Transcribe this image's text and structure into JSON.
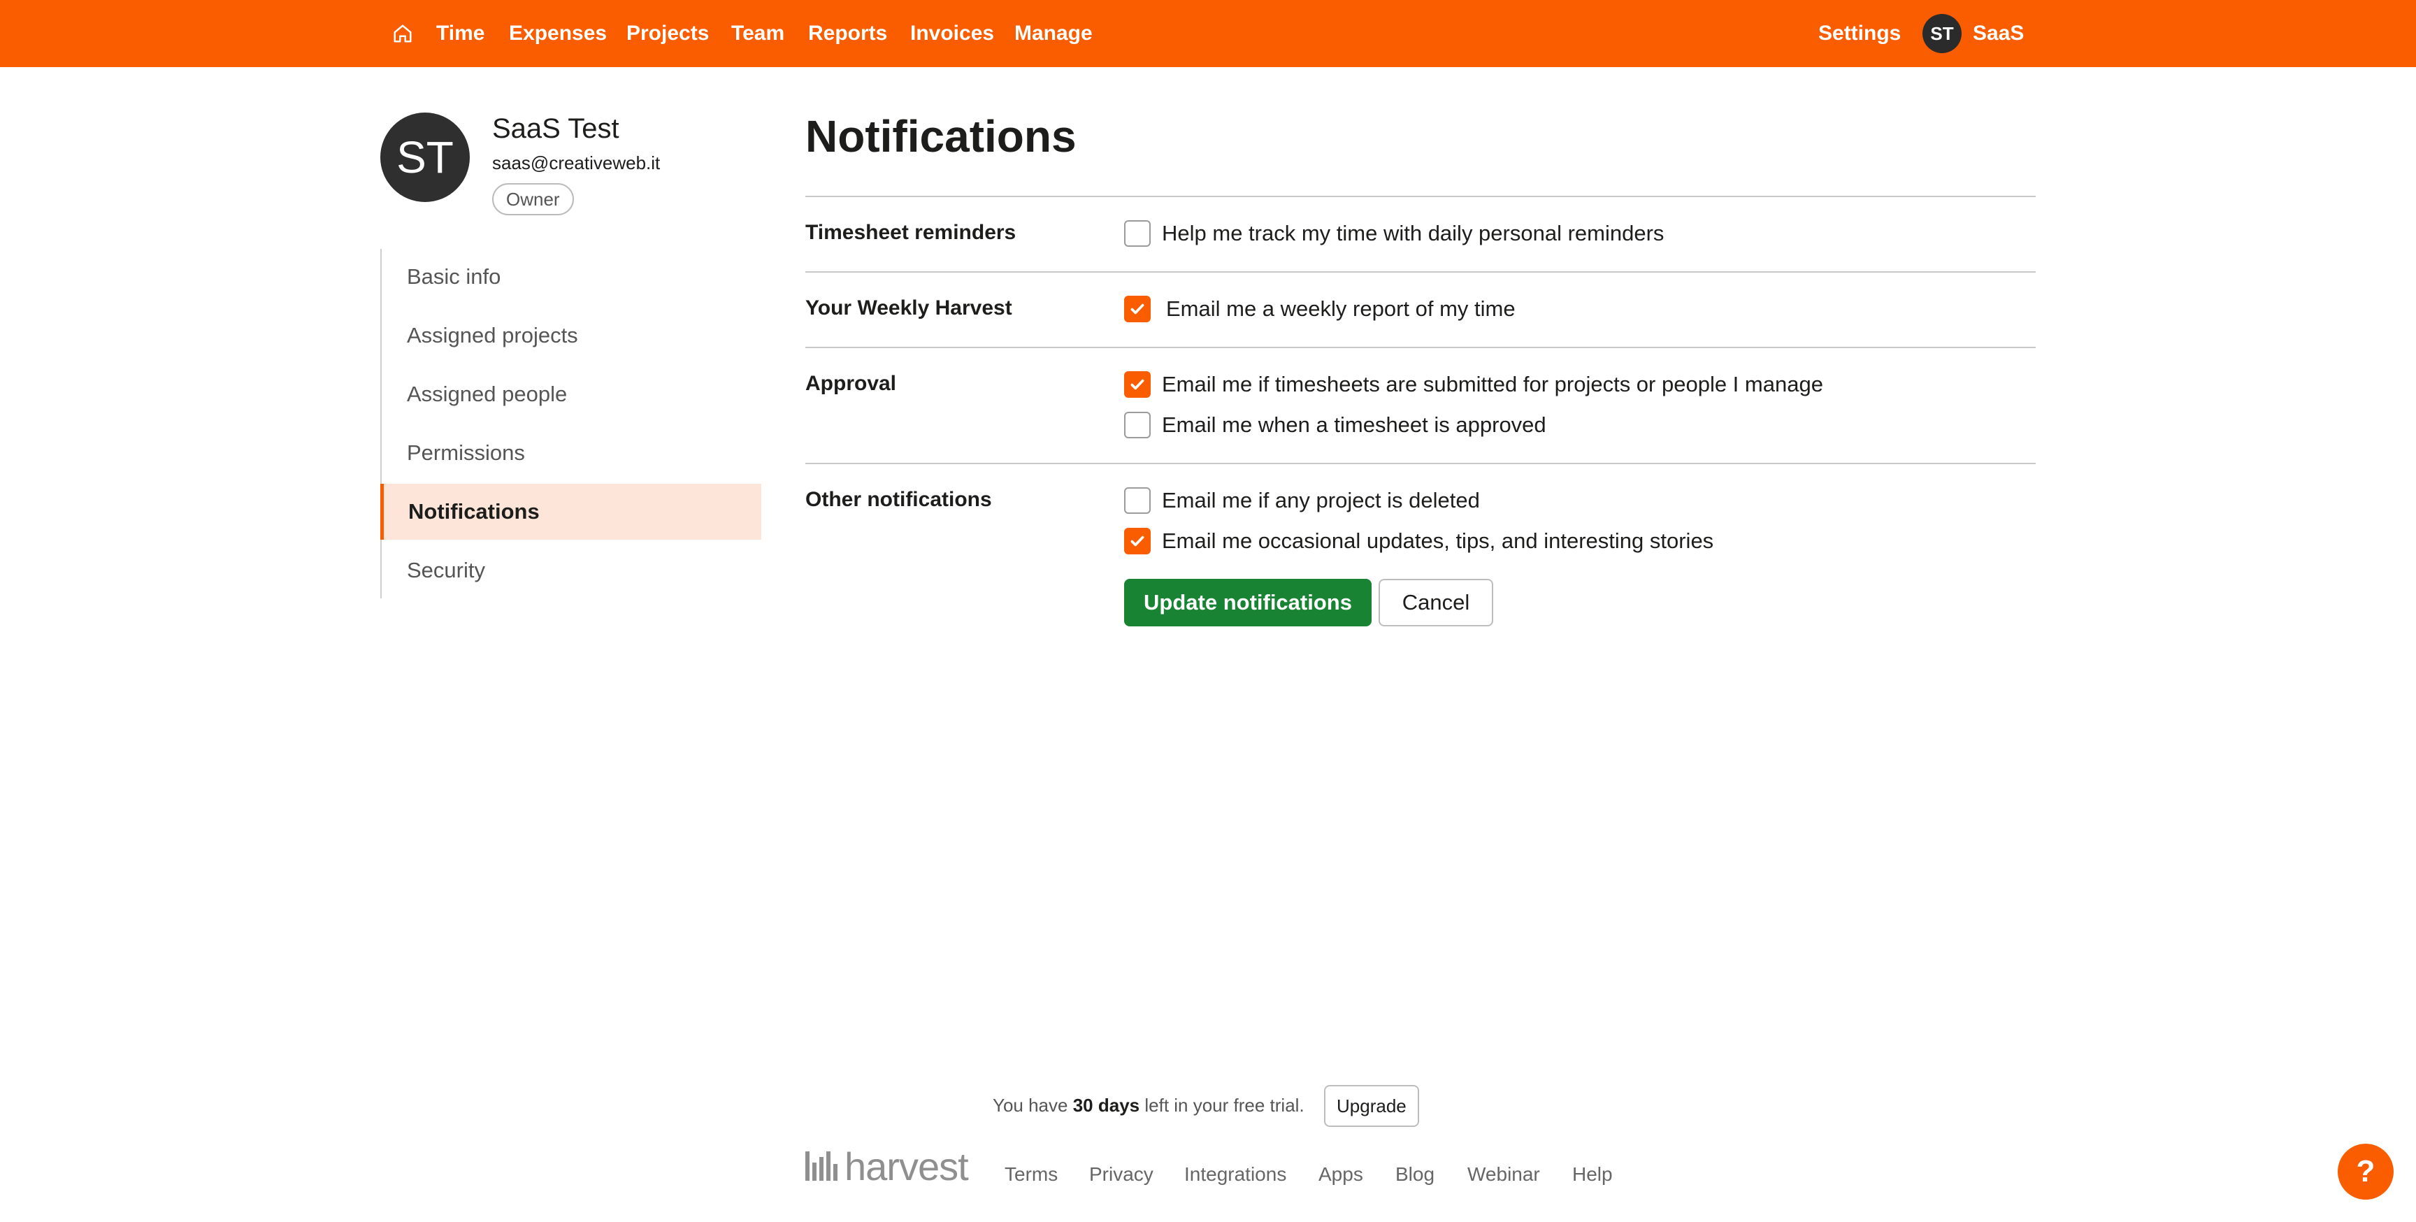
{
  "nav": {
    "items": [
      "Time",
      "Expenses",
      "Projects",
      "Team",
      "Reports",
      "Invoices",
      "Manage"
    ],
    "settings": "Settings",
    "avatar_initials": "ST",
    "account_label": "SaaS"
  },
  "profile": {
    "initials": "ST",
    "name": "SaaS Test",
    "email": "saas@creativeweb.it",
    "role": "Owner"
  },
  "sidebar": {
    "items": [
      {
        "label": "Basic info"
      },
      {
        "label": "Assigned projects"
      },
      {
        "label": "Assigned people"
      },
      {
        "label": "Permissions"
      },
      {
        "label": "Notifications",
        "active": true
      },
      {
        "label": "Security"
      }
    ]
  },
  "main": {
    "title": "Notifications",
    "sections": [
      {
        "label": "Timesheet reminders",
        "options": [
          {
            "label": "Help me track my time with daily personal reminders",
            "checked": false
          }
        ]
      },
      {
        "label": "Your Weekly Harvest",
        "options": [
          {
            "label": "Email me a weekly report of my time",
            "checked": true
          }
        ]
      },
      {
        "label": "Approval",
        "options": [
          {
            "label": "Email me if timesheets are submitted for projects or people I manage",
            "checked": true
          },
          {
            "label": "Email me when a timesheet is approved",
            "checked": false
          }
        ]
      },
      {
        "label": "Other notifications",
        "options": [
          {
            "label": "Email me if any project is deleted",
            "checked": false
          },
          {
            "label": "Email me occasional updates, tips, and interesting stories",
            "checked": true
          }
        ]
      }
    ],
    "update_button": "Update notifications",
    "cancel_button": "Cancel"
  },
  "footer": {
    "trial_prefix": "You have",
    "trial_days": "30 days",
    "trial_suffix": "left in your free trial.",
    "upgrade": "Upgrade",
    "logo_text": "harvest",
    "links": [
      "Terms",
      "Privacy",
      "Integrations",
      "Apps",
      "Blog",
      "Webinar",
      "Help"
    ]
  },
  "help_fab": "?",
  "colors": {
    "brand": "#fa5d00",
    "primary_button": "#188433",
    "active_nav_bg": "#fde5d9"
  }
}
